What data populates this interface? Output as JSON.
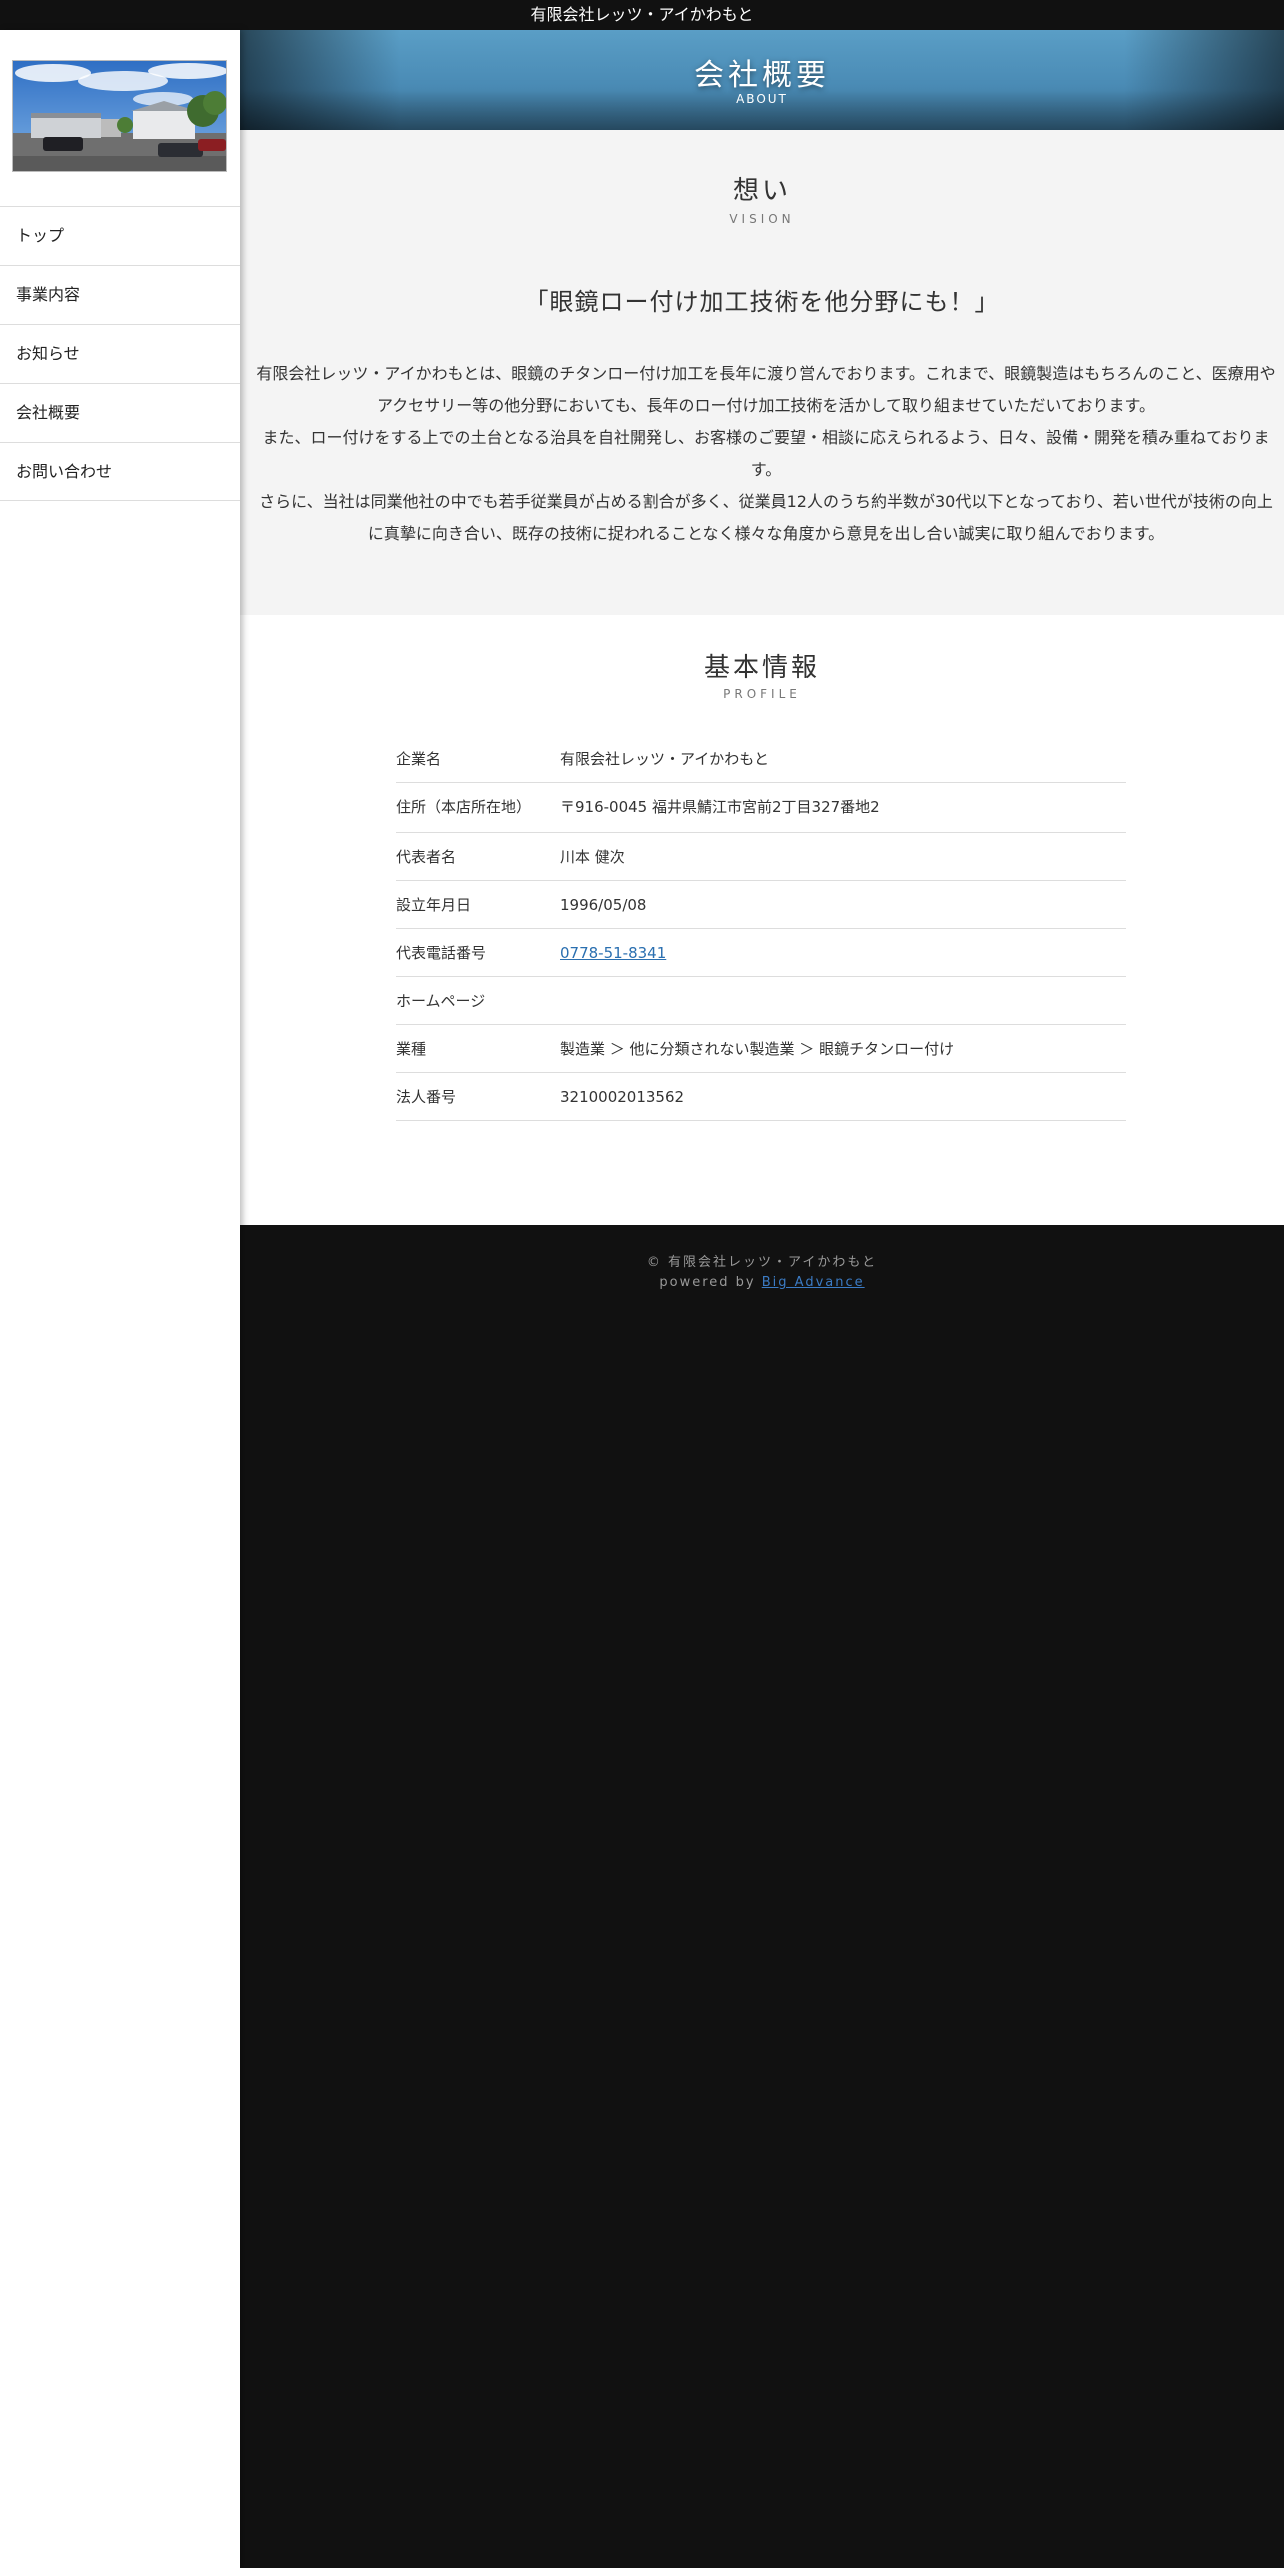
{
  "site": {
    "title": "有限会社レッツ・アイかわもと"
  },
  "sidebar": {
    "photo_icon": "building-photo",
    "items": [
      {
        "label": "トップ"
      },
      {
        "label": "事業内容"
      },
      {
        "label": "お知らせ"
      },
      {
        "label": "会社概要"
      },
      {
        "label": "お問い合わせ"
      }
    ]
  },
  "hero": {
    "title": "会社概要",
    "subtitle": "ABOUT"
  },
  "vision": {
    "title": "想い",
    "subtitle": "VISION",
    "headline": "「眼鏡ロー付け加工技術を他分野にも！」",
    "paragraphs": [
      "有限会社レッツ・アイかわもとは、眼鏡のチタンロー付け加工を長年に渡り営んでおります。これまで、眼鏡製造はもちろんのこと、医療用やアクセサリー等の他分野においても、長年のロー付け加工技術を活かして取り組ませていただいております。",
      "また、ロー付けをする上での土台となる治具を自社開発し、お客様のご要望・相談に応えられるよう、日々、設備・開発を積み重ねております。",
      "さらに、当社は同業他社の中でも若手従業員が占める割合が多く、従業員12人のうち約半数が30代以下となっており、若い世代が技術の向上に真摯に向き合い、既存の技術に捉われることなく様々な角度から意見を出し合い誠実に取り組んでおります。"
    ]
  },
  "profile": {
    "title": "基本情報",
    "subtitle": "PROFILE",
    "rows": [
      {
        "key": "企業名",
        "value": "有限会社レッツ・アイかわもと"
      },
      {
        "key": "住所（本店所在地）",
        "value": "〒916-0045 福井県鯖江市宮前2丁目327番地2"
      },
      {
        "key": "代表者名",
        "value": "川本 健次"
      },
      {
        "key": "設立年月日",
        "value": "1996/05/08"
      },
      {
        "key": "代表電話番号",
        "value": "0778-51-8341"
      },
      {
        "key": "ホームページ",
        "value": ""
      },
      {
        "key": "業種",
        "value": "製造業 ＞ 他に分類されない製造業 ＞ 眼鏡チタンロー付け"
      },
      {
        "key": "法人番号",
        "value": "3210002013562"
      }
    ]
  },
  "footer": {
    "copyright": "© 有限会社レッツ・アイかわもと",
    "powered_prefix": "powered by ",
    "powered_link": "Big Advance"
  },
  "colors": {
    "topbar": "#111111",
    "hero": "#4a8bb5",
    "vision_bg": "#f4f4f4",
    "link": "#2a6fb0"
  }
}
